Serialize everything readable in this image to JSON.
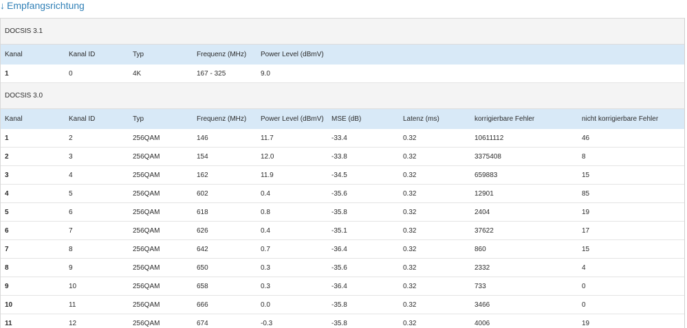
{
  "section_title": "Empfangsrichtung",
  "section_arrow": "↓",
  "docsis31": {
    "label": "DOCSIS 3.1",
    "headers": [
      "Kanal",
      "Kanal ID",
      "Typ",
      "Frequenz (MHz)",
      "Power Level (dBmV)"
    ],
    "rows": [
      [
        "1",
        "0",
        "4K",
        "167 - 325",
        "9.0"
      ]
    ]
  },
  "docsis30": {
    "label": "DOCSIS 3.0",
    "headers": [
      "Kanal",
      "Kanal ID",
      "Typ",
      "Frequenz (MHz)",
      "Power Level (dBmV)",
      "MSE (dB)",
      "Latenz (ms)",
      "korrigierbare Fehler",
      "nicht korrigierbare Fehler"
    ],
    "rows": [
      [
        "1",
        "2",
        "256QAM",
        "146",
        "11.7",
        "-33.4",
        "0.32",
        "10611112",
        "46"
      ],
      [
        "2",
        "3",
        "256QAM",
        "154",
        "12.0",
        "-33.8",
        "0.32",
        "3375408",
        "8"
      ],
      [
        "3",
        "4",
        "256QAM",
        "162",
        "11.9",
        "-34.5",
        "0.32",
        "659883",
        "15"
      ],
      [
        "4",
        "5",
        "256QAM",
        "602",
        "0.4",
        "-35.6",
        "0.32",
        "12901",
        "85"
      ],
      [
        "5",
        "6",
        "256QAM",
        "618",
        "0.8",
        "-35.8",
        "0.32",
        "2404",
        "19"
      ],
      [
        "6",
        "7",
        "256QAM",
        "626",
        "0.4",
        "-35.1",
        "0.32",
        "37622",
        "17"
      ],
      [
        "7",
        "8",
        "256QAM",
        "642",
        "0.7",
        "-36.4",
        "0.32",
        "860",
        "15"
      ],
      [
        "8",
        "9",
        "256QAM",
        "650",
        "0.3",
        "-35.6",
        "0.32",
        "2332",
        "4"
      ],
      [
        "9",
        "10",
        "256QAM",
        "658",
        "0.3",
        "-36.4",
        "0.32",
        "733",
        "0"
      ],
      [
        "10",
        "11",
        "256QAM",
        "666",
        "0.0",
        "-35.8",
        "0.32",
        "3466",
        "0"
      ],
      [
        "11",
        "12",
        "256QAM",
        "674",
        "-0.3",
        "-35.8",
        "0.32",
        "4006",
        "19"
      ]
    ]
  },
  "colors": {
    "title": "#2f7fb6",
    "header_bg": "#d8e9f7",
    "group_bg": "#f4f4f4"
  }
}
